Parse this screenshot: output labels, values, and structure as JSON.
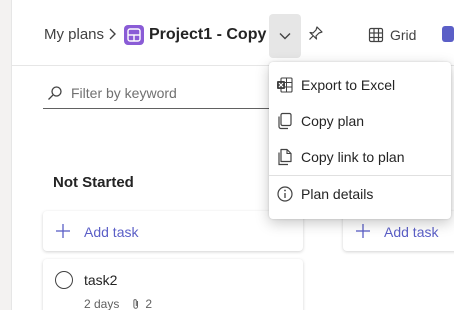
{
  "header": {
    "breadcrumb_root": "My plans",
    "plan_title": "Project1 - Copy",
    "grid_tab_label": "Grid"
  },
  "filter": {
    "placeholder": "Filter by keyword"
  },
  "bucket": {
    "title": "Not Started",
    "add_task_label": "Add task"
  },
  "second_bucket": {
    "add_task_label": "Add task"
  },
  "task": {
    "title": "task2",
    "duration": "2 days",
    "attachments": "2"
  },
  "menu": {
    "items": [
      {
        "label": "Export to Excel",
        "icon": "excel-icon"
      },
      {
        "label": "Copy plan",
        "icon": "copy-icon"
      },
      {
        "label": "Copy link to plan",
        "icon": "copy-link-icon"
      },
      {
        "label": "Plan details",
        "icon": "info-icon"
      }
    ]
  },
  "colors": {
    "accent": "#5b5fc7",
    "plan_icon": "#8a5cd6",
    "excel": "#107c41"
  }
}
